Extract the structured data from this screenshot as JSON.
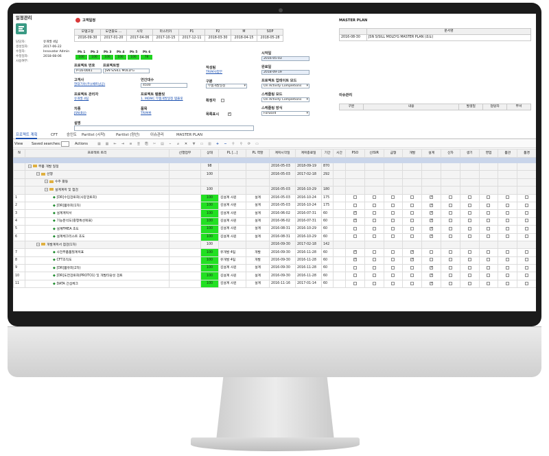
{
  "left_panel": {
    "title": "일정관리",
    "meta": [
      {
        "k": "담당자:",
        "v": "유개발 4팀"
      },
      {
        "k": "생성일자:",
        "v": "2017-06-22"
      },
      {
        "k": "수정자:",
        "v": "Innovator Admin"
      },
      {
        "k": "수정일자:",
        "v": "2018-08-06"
      },
      {
        "k": "사용여부:",
        "v": ""
      }
    ]
  },
  "customer": {
    "heading": "고객일정",
    "headers": [
      "모델고정",
      "도면출도 ...",
      "시작",
      "마스터카",
      "P1",
      "P2",
      "M",
      "SOP"
    ],
    "values": [
      "2016-09-30",
      "2017-01-20",
      "2017-04-06",
      "2017-10-15",
      "2017-12-11",
      "2018-03-30",
      "2018-04-15",
      "2018-05-28"
    ]
  },
  "phases": {
    "labels": [
      "Ph 1",
      "Ph 2",
      "Ph 3",
      "Ph 4",
      "Ph 5",
      "Ph 6"
    ],
    "values": [
      "100",
      "100",
      "100",
      "100",
      "100",
      "78"
    ]
  },
  "project": {
    "no_label": "프로젝트 번호",
    "no_value": "P-16-0041",
    "name_label": "프로젝트명",
    "name_value": "JSN S/SILL MOLD'G",
    "customer_label": "고객사",
    "customer_value": "현대기아(주)(베트남공)",
    "qty_label": "연간대수",
    "qty_value": "4500",
    "pm_label": "프로젝트 관리자",
    "pm_value": "유개발 4팀",
    "template_label": "프로젝트 템플릿",
    "template_value": "1. MOMC 부품개발일정 템플릿",
    "car_label": "차종",
    "car_value": "JSN(BU)",
    "item_label": "품목",
    "item_value": "TRIM류",
    "memo_label": "설명",
    "writer_label": "작성팀",
    "writer_value": "TRIM사업부",
    "type_label": "구분",
    "type_value": "부품개발일정",
    "confirm_label": "확정자",
    "list_label": "목록표시",
    "start_label": "시작일",
    "start_value": "2016-05-03",
    "end_label": "완료일",
    "end_value": "2018-09-19",
    "update_label": "프로젝트 업데이트 모드",
    "update_value": "On Activity Completions",
    "sched_label": "스케줄링 모드",
    "sched_value": "On Activity Completions",
    "sched_type_label": "스케줄링 방식",
    "sched_type_value": "Forward"
  },
  "master_plan": {
    "title": "MASTER PLAN",
    "col": "문서명",
    "date": "2016-08-30",
    "doc": "JSN S/SILL MOLD'G MASTER PLAN (초도)"
  },
  "issue": {
    "title": "이슈관리",
    "cols": [
      "구분",
      "내용",
      "발생일",
      "담당자",
      "부서"
    ]
  },
  "tabs": [
    "프로젝트 계획",
    "CFT",
    "승인도",
    "Partlist (시작)",
    "Partlist (양산)",
    "이슈관리",
    "MASTER PLAN"
  ],
  "toolbar": {
    "view": "View",
    "saved": "Saved searches:",
    "actions": "Actions"
  },
  "grid": {
    "headers": [
      "N",
      "프로젝트 트리",
      "선행업무",
      "상태",
      "PL [...]",
      "PL 역할",
      "계획시작일",
      "계획종료일",
      "기간",
      "시간",
      "PSO",
      "신ISIR",
      "금형",
      "개발",
      "설계",
      "신차",
      "생기",
      "영업",
      "품관",
      "품경"
    ],
    "rows": [
      {
        "n": "",
        "name": "부품 개발 일정",
        "lvl": 0,
        "t": "fold",
        "st": "98",
        "pl": "",
        "role": "",
        "s": "2016-05-03",
        "e": "2018-09-19",
        "d": "870",
        "chk": null,
        "gray": true
      },
      {
        "n": "",
        "name": "선행",
        "lvl": 1,
        "t": "fold",
        "st": "100",
        "pl": "",
        "role": "",
        "s": "2016-05-03",
        "e": "2017-02-18",
        "d": "292",
        "chk": null,
        "gray": true
      },
      {
        "n": "",
        "name": "수주 활동",
        "lvl": 2,
        "t": "fold",
        "st": "",
        "pl": "",
        "role": "",
        "s": "",
        "e": "",
        "d": "",
        "chk": null,
        "gray": true
      },
      {
        "n": "",
        "name": "설계계획 및 점검",
        "lvl": 2,
        "t": "fold",
        "st": "100",
        "pl": "",
        "role": "",
        "s": "2016-05-03",
        "e": "2016-10-29",
        "d": "180",
        "chk": null,
        "gray": true
      },
      {
        "n": "1",
        "name": "[DR]수입검토회(사양검토회)",
        "lvl": 3,
        "t": "task",
        "st": "100",
        "pl": "김설계 사원",
        "role": "설계",
        "s": "2016-05-03",
        "e": "2016-10-24",
        "d": "175",
        "chk": [
          0,
          0,
          0,
          0,
          1,
          0,
          0,
          0,
          0,
          0
        ]
      },
      {
        "n": "2",
        "name": "[DR]품유회(1차)",
        "lvl": 3,
        "t": "task",
        "st": "100",
        "pl": "김설계 사원",
        "role": "설계",
        "s": "2016-05-03",
        "e": "2016-10-24",
        "d": "175",
        "chk": [
          0,
          0,
          0,
          0,
          1,
          0,
          0,
          0,
          0,
          0
        ]
      },
      {
        "n": "3",
        "name": "설계계획서",
        "lvl": 3,
        "t": "task",
        "st": "100",
        "pl": "김설계 사원",
        "role": "설계",
        "s": "2016-06-02",
        "e": "2016-07-31",
        "d": "60",
        "chk": [
          1,
          0,
          0,
          0,
          1,
          0,
          0,
          0,
          0,
          0
        ]
      },
      {
        "n": "4",
        "name": "기능분석도(중행특성목표)",
        "lvl": 3,
        "t": "task",
        "st": "100",
        "pl": "김설계 사원",
        "role": "설계",
        "s": "2016-06-02",
        "e": "2016-07-31",
        "d": "60",
        "chk": [
          1,
          0,
          0,
          0,
          1,
          0,
          0,
          0,
          0,
          0
        ]
      },
      {
        "n": "5",
        "name": "설계FMEA 초도",
        "lvl": 3,
        "t": "task",
        "st": "100",
        "pl": "김설계 사원",
        "role": "설계",
        "s": "2016-08-31",
        "e": "2016-10-29",
        "d": "60",
        "chk": [
          0,
          0,
          0,
          0,
          1,
          0,
          0,
          0,
          0,
          0
        ]
      },
      {
        "n": "6",
        "name": "설계체크리스트 초도",
        "lvl": 3,
        "t": "task",
        "st": "100",
        "pl": "김설계 사원",
        "role": "설계",
        "s": "2016-08-31",
        "e": "2016-10-29",
        "d": "60",
        "chk": [
          0,
          0,
          0,
          0,
          1,
          0,
          0,
          0,
          0,
          0
        ]
      },
      {
        "n": "",
        "name": "개발계획서 점검(1차)",
        "lvl": 1,
        "t": "fold",
        "st": "100",
        "pl": "",
        "role": "",
        "s": "2016-09-30",
        "e": "2017-02-18",
        "d": "142",
        "chk": null,
        "gray": true
      },
      {
        "n": "7",
        "name": "사전부품품질계획표",
        "lvl": 3,
        "t": "task",
        "st": "100",
        "pl": "유개발 4팀",
        "role": "개발",
        "s": "2016-09-30",
        "e": "2016-11-28",
        "d": "60",
        "chk": [
          1,
          0,
          0,
          1,
          0,
          0,
          0,
          0,
          0,
          0
        ]
      },
      {
        "n": "8",
        "name": "CFT조직도",
        "lvl": 3,
        "t": "task",
        "st": "100",
        "pl": "유개발 4팀",
        "role": "개발",
        "s": "2016-09-30",
        "e": "2016-11-28",
        "d": "60",
        "chk": [
          1,
          0,
          0,
          1,
          0,
          0,
          0,
          0,
          0,
          0
        ]
      },
      {
        "n": "9",
        "name": "[DR]품유회(2차)",
        "lvl": 3,
        "t": "task",
        "st": "100",
        "pl": "김설계 사원",
        "role": "설계",
        "s": "2016-09-30",
        "e": "2016-11-28",
        "d": "60",
        "chk": [
          0,
          0,
          0,
          0,
          1,
          0,
          0,
          0,
          0,
          0
        ]
      },
      {
        "n": "10",
        "name": "[DR]도면검토회(PROTO1) 및 개발타당성 검토",
        "lvl": 3,
        "t": "task",
        "st": "100",
        "pl": "김설계 사원",
        "role": "설계",
        "s": "2016-09-30",
        "e": "2016-11-28",
        "d": "60",
        "chk": [
          0,
          0,
          0,
          0,
          1,
          0,
          0,
          0,
          0,
          0
        ]
      },
      {
        "n": "11",
        "name": "DATA 간섭체크",
        "lvl": 3,
        "t": "task",
        "st": "100",
        "pl": "김설계 사원",
        "role": "설계",
        "s": "2016-11-16",
        "e": "2017-01-14",
        "d": "60",
        "chk": [
          0,
          0,
          0,
          0,
          1,
          0,
          0,
          0,
          0,
          0
        ]
      }
    ]
  }
}
